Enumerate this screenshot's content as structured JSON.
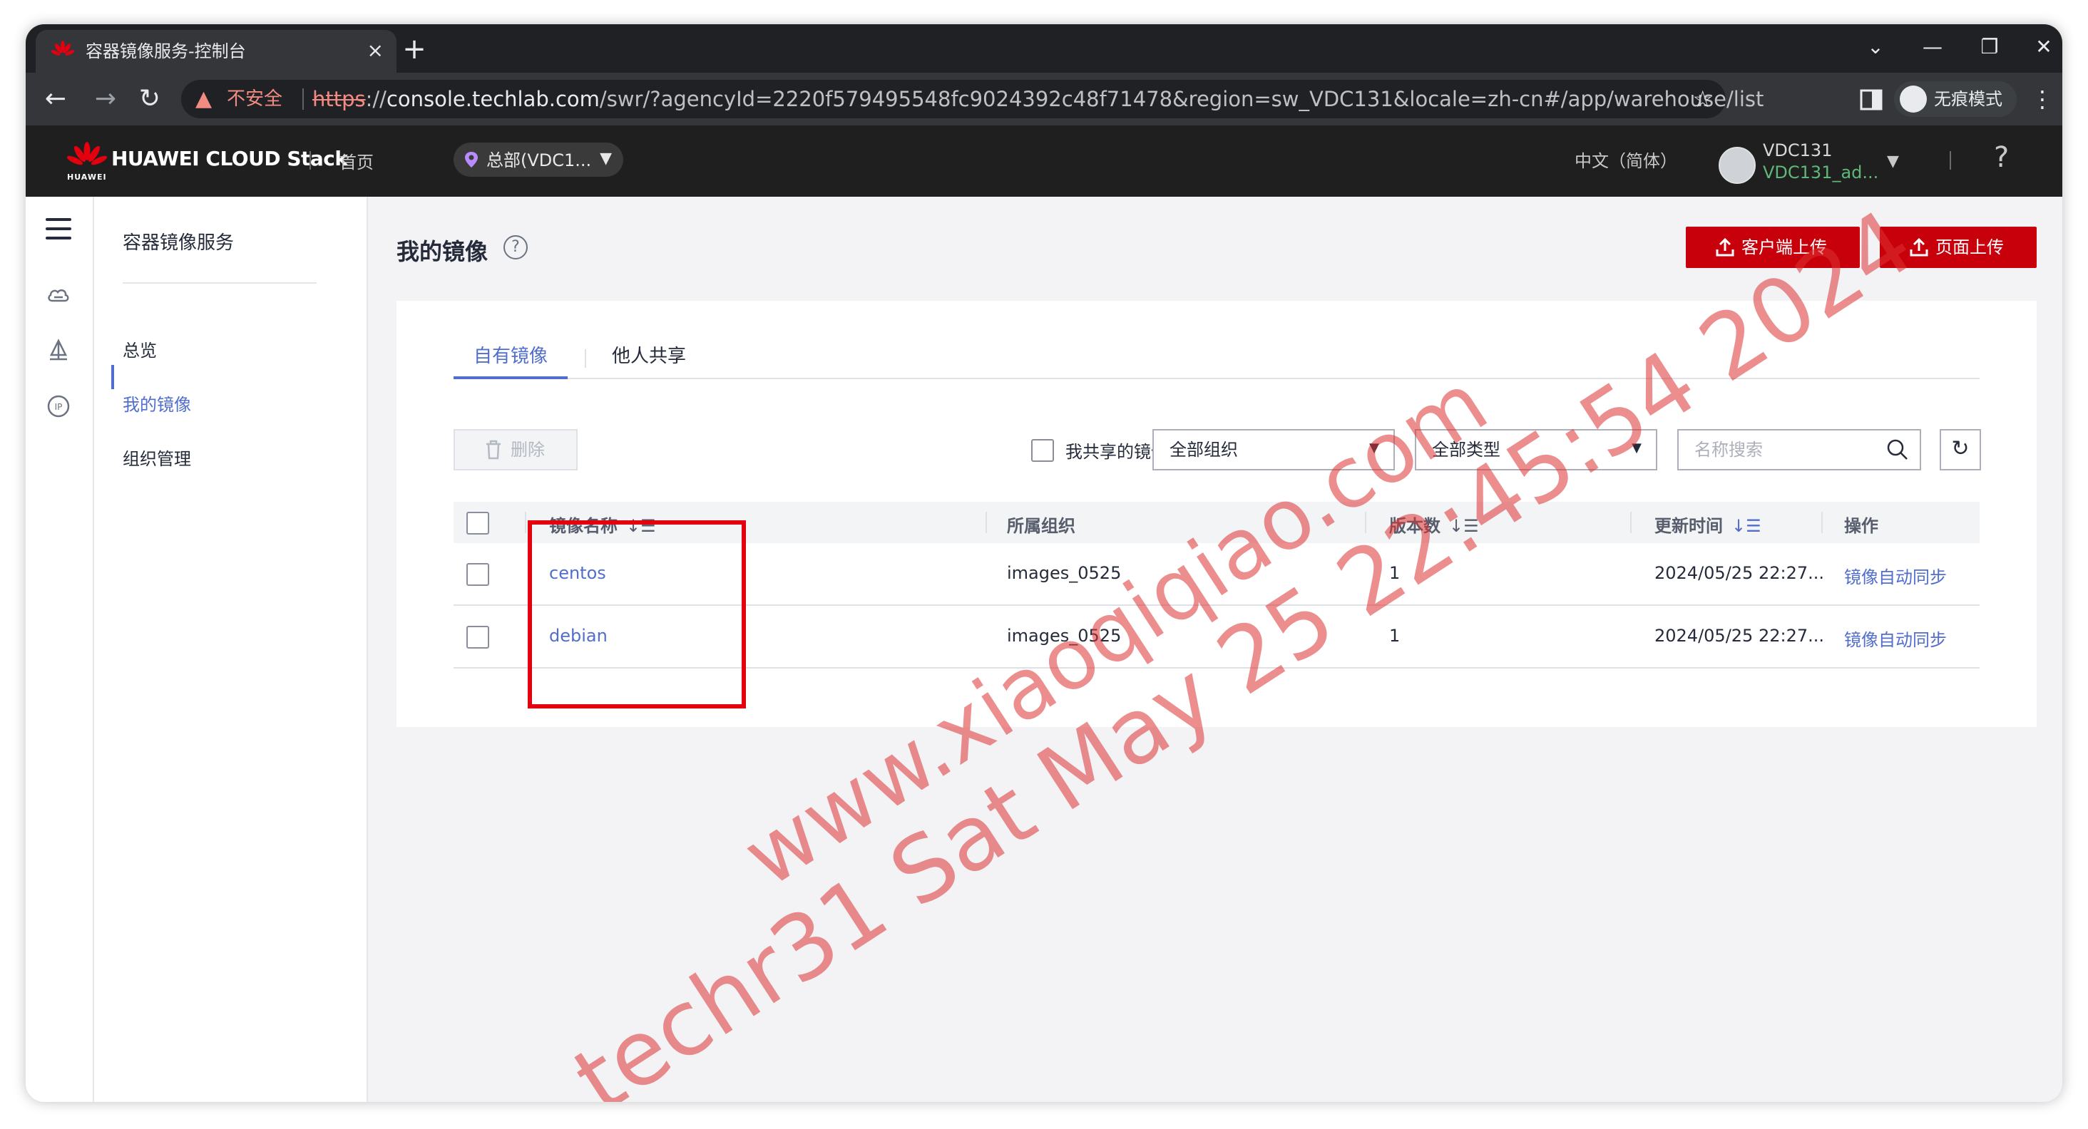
{
  "browser": {
    "tab_title": "容器镜像服务-控制台",
    "tab_close": "×",
    "new_tab": "+",
    "url_scheme": "https",
    "url_host": "console.techlab.com",
    "url_rest": "/swr/?agencyId=2220f579495548fc9024392c48f71478&region=sw_VDC131&locale=zh-cn#/app/warehouse/list",
    "security_label": "不安全",
    "incognito_label": "无痕模式",
    "window_controls": {
      "tab_search": "⌄",
      "minimize": "—",
      "restore": "❐",
      "close": "✕"
    }
  },
  "header": {
    "brand": "HUAWEI CLOUD Stack",
    "brand_logo_text": "HUAWEI",
    "home": "首页",
    "region": "总部(VDC1...",
    "language": "中文（简体）",
    "tenant": "VDC131",
    "account": "VDC131_ad...",
    "help": "?"
  },
  "sidebar": {
    "service_title": "容器镜像服务",
    "items": [
      {
        "label": "总览",
        "active": false
      },
      {
        "label": "我的镜像",
        "active": true
      },
      {
        "label": "组织管理",
        "active": false
      }
    ],
    "rail_icons": [
      "menu-icon",
      "cloud-icon",
      "deploy-icon",
      "ip-icon"
    ]
  },
  "main": {
    "title": "我的镜像",
    "help": "?",
    "client_upload": "客户端上传",
    "page_upload": "页面上传",
    "tabs": [
      {
        "label": "自有镜像",
        "active": true
      },
      {
        "label": "他人共享",
        "active": false
      }
    ],
    "toolbar": {
      "delete_label": "删除",
      "shared_by_me": "我共享的镜像",
      "org_filter": "全部组织",
      "type_filter": "全部类型",
      "search_placeholder": "名称搜索"
    },
    "table": {
      "columns": [
        "镜像名称",
        "所属组织",
        "版本数",
        "更新时间",
        "操作"
      ],
      "rows": [
        {
          "name": "centos",
          "org": "images_0525",
          "versions": "1",
          "updated": "2024/05/25 22:27...",
          "action": "镜像自动同步"
        },
        {
          "name": "debian",
          "org": "images_0525",
          "versions": "1",
          "updated": "2024/05/25 22:27...",
          "action": "镜像自动同步"
        }
      ]
    }
  },
  "watermark": {
    "line1": "www.xiaoqiqiao.com",
    "line2": "techr31 Sat May 25 22:45:54 2024"
  },
  "colors": {
    "accent": "#526ecc",
    "brand_red": "#c7000b",
    "highlight": "#e3000f",
    "header_bg": "#1f1f1f",
    "account_green": "#5fb878"
  }
}
